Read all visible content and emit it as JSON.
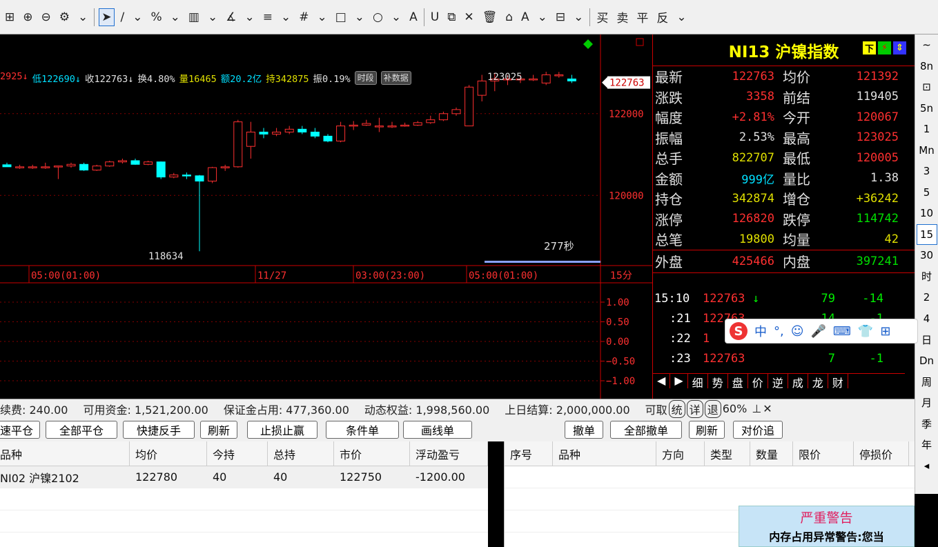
{
  "toolbar": {
    "items": [
      "⊞",
      "⊕",
      "⊖",
      "⚙",
      "⌄",
      "➤",
      "∕",
      "⌄",
      "%",
      "⌄",
      "▥",
      "⌄",
      "∡",
      "⌄",
      "≡",
      "⌄",
      "#",
      "⌄",
      "□",
      "⌄",
      "○",
      "⌄",
      "A",
      "U",
      "⧉",
      "✕",
      "🗑",
      "⌂",
      "A",
      "⌄",
      "⊟",
      "⌄",
      "买",
      "卖",
      "平",
      "反",
      "⌄"
    ]
  },
  "infobar": {
    "high": "2925↓",
    "low": "低122690↓",
    "close": "收122763↓",
    "turnover": "换4.80%",
    "vol": "量16465",
    "amount": "额20.2亿",
    "oi": "持342875",
    "amp": "振0.19%",
    "tag1": "时段",
    "tag2": "补数据"
  },
  "chart_data": {
    "type": "candlestick",
    "ylim": [
      118300,
      123600
    ],
    "yticks": [
      {
        "v": 122000,
        "label": "122000"
      },
      {
        "v": 120000,
        "label": "120000"
      }
    ],
    "last_price_label": "122763",
    "annotations": [
      {
        "text": "123025",
        "x": 34,
        "v": 123025
      },
      {
        "text": "118634",
        "x": 14,
        "v": 118634
      }
    ],
    "xticks": [
      {
        "i": 0,
        "label": "05:00(01:00)"
      },
      {
        "i": 17,
        "label": "11/27"
      },
      {
        "i": 24,
        "label": "03:00(23:00)"
      },
      {
        "i": 32,
        "label": "05:00(01:00)"
      }
    ],
    "period": "15分",
    "countdown": "277秒",
    "candles": [
      [
        120750,
        120800,
        120700,
        120700
      ],
      [
        120700,
        120750,
        120650,
        120700
      ],
      [
        120700,
        120750,
        120650,
        120700
      ],
      [
        120700,
        120800,
        120650,
        120700
      ],
      [
        120700,
        120730,
        120400,
        120720
      ],
      [
        120720,
        120800,
        120680,
        120760
      ],
      [
        120760,
        120800,
        120600,
        120620
      ],
      [
        120620,
        120750,
        120600,
        120720
      ],
      [
        120720,
        120850,
        120700,
        120820
      ],
      [
        120820,
        120900,
        120780,
        120850
      ],
      [
        120850,
        120900,
        120750,
        120760
      ],
      [
        120760,
        120850,
        120740,
        120820
      ],
      [
        120820,
        120830,
        120400,
        120450
      ],
      [
        120450,
        120550,
        120420,
        120500
      ],
      [
        120500,
        120560,
        120400,
        120480
      ],
      [
        120480,
        120500,
        118634,
        120350
      ],
      [
        120350,
        120700,
        120300,
        120680
      ],
      [
        120680,
        120750,
        120600,
        120700
      ],
      [
        120700,
        121850,
        120680,
        121800
      ],
      [
        121200,
        121800,
        120900,
        121550
      ],
      [
        121550,
        121650,
        121400,
        121500
      ],
      [
        121500,
        121650,
        121450,
        121550
      ],
      [
        121550,
        121700,
        121500,
        121620
      ],
      [
        121620,
        121700,
        121500,
        121550
      ],
      [
        121550,
        121650,
        121400,
        121450
      ],
      [
        121450,
        121500,
        121300,
        121330
      ],
      [
        121330,
        121800,
        121300,
        121700
      ],
      [
        121700,
        121820,
        121600,
        121720
      ],
      [
        121720,
        121850,
        121700,
        121760
      ],
      [
        121700,
        121900,
        121550,
        121700
      ],
      [
        121700,
        121800,
        121650,
        121700
      ],
      [
        121700,
        121780,
        121680,
        121720
      ],
      [
        121720,
        121820,
        121700,
        121780
      ],
      [
        121780,
        121950,
        121750,
        121850
      ],
      [
        121850,
        122050,
        121820,
        122000
      ],
      [
        122000,
        122150,
        121950,
        122100
      ],
      [
        121700,
        122700,
        121700,
        122650
      ],
      [
        122450,
        122950,
        122300,
        122800
      ],
      [
        122800,
        123000,
        122550,
        122850
      ],
      [
        122850,
        122950,
        122700,
        122850
      ],
      [
        122850,
        122950,
        122750,
        122850
      ],
      [
        122850,
        122950,
        122800,
        122850
      ],
      [
        122750,
        123025,
        122700,
        122950
      ],
      [
        122950,
        123020,
        122880,
        122950
      ],
      [
        122850,
        122950,
        122750,
        122800
      ]
    ],
    "osc": {
      "ylim": [
        -1.1,
        1.1
      ],
      "yticks": [
        "1.00",
        "0.50",
        "0.00",
        "−0.50",
        "−1.00"
      ]
    }
  },
  "quote": {
    "title": "NI13 沪镍指数",
    "icons": [
      "下",
      "⚡",
      "⇕"
    ],
    "rows": [
      {
        "l1": "最新",
        "v1": "122763",
        "c1": "#ff3030",
        "l2": "均价",
        "v2": "121392",
        "c2": "#ff3030"
      },
      {
        "l1": "涨跌",
        "v1": "3358",
        "c1": "#ff3030",
        "l2": "前结",
        "v2": "119405",
        "c2": "#e0e0e0"
      },
      {
        "l1": "幅度",
        "v1": "+2.81%",
        "c1": "#ff3030",
        "l2": "今开",
        "v2": "120067",
        "c2": "#ff3030"
      },
      {
        "l1": "振幅",
        "v1": "2.53%",
        "c1": "#e0e0e0",
        "l2": "最高",
        "v2": "123025",
        "c2": "#ff3030"
      },
      {
        "l1": "总手",
        "v1": "822707",
        "c1": "#e0e000",
        "l2": "最低",
        "v2": "120005",
        "c2": "#ff3030"
      },
      {
        "l1": "金额",
        "v1": "999亿",
        "c1": "#00e0ff",
        "l2": "量比",
        "v2": "1.38",
        "c2": "#e0e0e0"
      },
      {
        "l1": "持仓",
        "v1": "342874",
        "c1": "#e0e000",
        "l2": "增仓",
        "v2": "+36242",
        "c2": "#e0e000"
      },
      {
        "l1": "涨停",
        "v1": "126820",
        "c1": "#ff3030",
        "l2": "跌停",
        "v2": "114742",
        "c2": "#00e000"
      },
      {
        "l1": "总笔",
        "v1": "19800",
        "c1": "#e0e000",
        "l2": "均量",
        "v2": "42",
        "c2": "#e0e000"
      },
      {
        "l1": "外盘",
        "v1": "425466",
        "c1": "#ff3030",
        "l2": "内盘",
        "v2": "397241",
        "c2": "#00e000"
      }
    ],
    "ticks": [
      {
        "t": "15:10",
        "p": "122763",
        "arrow": "↓",
        "v": "79",
        "d": "-14"
      },
      {
        "t": ":21",
        "p": "122763",
        "arrow": "",
        "v": "14",
        "d": "-1"
      },
      {
        "t": ":22",
        "p": "1",
        "arrow": "",
        "v": "",
        "d": ""
      },
      {
        "t": ":23",
        "p": "122763",
        "arrow": "",
        "v": "7",
        "d": "-1"
      }
    ],
    "tabs": [
      "◀",
      "▶",
      "细",
      "势",
      "盘",
      "价",
      "逆",
      "成",
      "龙",
      "财"
    ]
  },
  "periods": [
    "∼",
    "8n",
    "⊡",
    "5n",
    "1",
    "Mn",
    "3",
    "5",
    "10",
    "15",
    "30",
    "时",
    "2",
    "4",
    "日",
    "Dn",
    "周",
    "月",
    "季",
    "年",
    "◂"
  ],
  "period_active": "15",
  "account": {
    "fee": "续费: 240.00",
    "avail": "可用资金: 1,521,200.00",
    "margin": "保证金占用: 477,360.00",
    "equity": "动态权益: 1,998,560.00",
    "settle": "上日结算: 2,000,000.00",
    "withdraw": "可取",
    "tail": "60%",
    "b1": "统",
    "b2": "详",
    "b3": "退",
    "close": "✕"
  },
  "buttons_left": [
    "速平仓",
    "全部平仓",
    "快捷反手",
    "刷新",
    "止损止赢",
    "条件单",
    "画线单"
  ],
  "buttons_right": [
    "撤单",
    "全部撤单",
    "刷新",
    "对价追"
  ],
  "positions": {
    "headers": [
      "品种",
      "均价",
      "今持",
      "总持",
      "市价",
      "浮动盈亏"
    ],
    "rows": [
      [
        "NI02 沪镍2102",
        "122780",
        "40",
        "40",
        "122750",
        "-1200.00"
      ]
    ]
  },
  "orders": {
    "headers": [
      "序号",
      "品种",
      "方向",
      "类型",
      "数量",
      "限价",
      "停损价"
    ]
  },
  "warning": {
    "title": "严重警告",
    "text": "内存占用异常警告:您当"
  },
  "ime": {
    "items": [
      "S",
      "中",
      "°,",
      "☺",
      "🎤",
      "⌨",
      "👕",
      "⊞"
    ]
  }
}
